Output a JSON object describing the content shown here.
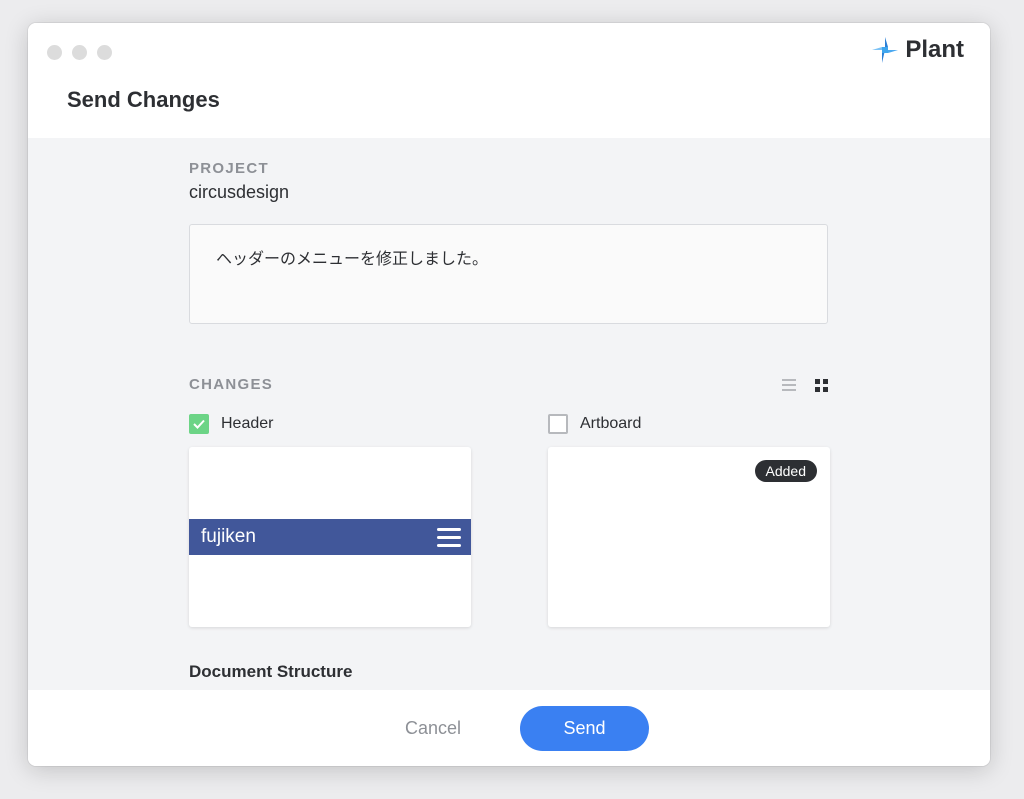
{
  "window": {
    "title": "Send Changes",
    "brand": "Plant"
  },
  "project": {
    "label": "PROJECT",
    "name": "circusdesign"
  },
  "message": {
    "value": "ヘッダーのメニューを修正しました。"
  },
  "changes": {
    "label": "CHANGES",
    "view_modes": [
      "list-icon",
      "grid-icon"
    ],
    "selected_view": "grid",
    "items": [
      {
        "name": "Header",
        "checked": true,
        "preview_text": "fujiken",
        "badge": ""
      },
      {
        "name": "Artboard",
        "checked": false,
        "preview_text": "",
        "badge": "Added"
      }
    ]
  },
  "document_structure": {
    "label": "Document Structure"
  },
  "footer": {
    "cancel_label": "Cancel",
    "send_label": "Send"
  },
  "colors": {
    "accent": "#3a80f2",
    "check": "#6cd486",
    "preview_bar": "#41579a",
    "brand_mark": "#3fa6ee"
  }
}
